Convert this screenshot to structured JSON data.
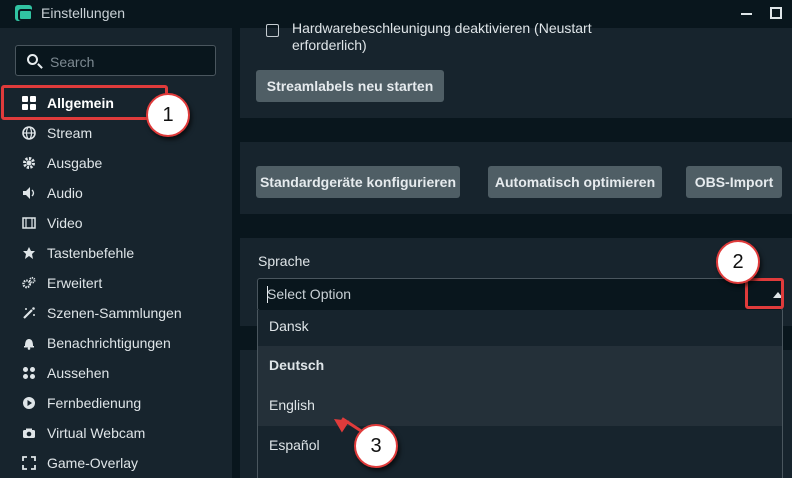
{
  "window": {
    "title": "Einstellungen"
  },
  "sidebar": {
    "search_placeholder": "Search",
    "items": [
      {
        "label": "Allgemein",
        "icon": "grid-icon"
      },
      {
        "label": "Stream",
        "icon": "globe-icon"
      },
      {
        "label": "Ausgabe",
        "icon": "gear-icon"
      },
      {
        "label": "Audio",
        "icon": "speaker-icon"
      },
      {
        "label": "Video",
        "icon": "film-icon"
      },
      {
        "label": "Tastenbefehle",
        "icon": "keyboard-icon"
      },
      {
        "label": "Erweitert",
        "icon": "gears-icon"
      },
      {
        "label": "Szenen-Sammlungen",
        "icon": "magic-wand-icon"
      },
      {
        "label": "Benachrichtigungen",
        "icon": "bell-icon"
      },
      {
        "label": "Aussehen",
        "icon": "apps-icon"
      },
      {
        "label": "Fernbedienung",
        "icon": "play-circle-icon"
      },
      {
        "label": "Virtual Webcam",
        "icon": "camera-icon"
      },
      {
        "label": "Game-Overlay",
        "icon": "expand-icon"
      }
    ]
  },
  "main": {
    "hardware_accel_label": "Hardwarebeschleunigung deaktivieren (Neustart erforderlich)",
    "restart_labels_button": "Streamlabels neu starten",
    "buttons": {
      "configure_devices": "Standardgeräte konfigurieren",
      "auto_optimize": "Automatisch optimieren",
      "obs_import": "OBS-Import"
    },
    "language": {
      "label": "Sprache",
      "placeholder": "Select Option",
      "options": [
        "Dansk",
        "Deutsch",
        "English",
        "Español"
      ]
    }
  },
  "annotations": {
    "callout_1": "1",
    "callout_2": "2",
    "callout_3": "3",
    "highlight_color": "#e03b3b"
  },
  "colors": {
    "background": "#09161d",
    "panel": "#17242d",
    "button": "#4f5e65",
    "accent": "#31c3a2"
  }
}
